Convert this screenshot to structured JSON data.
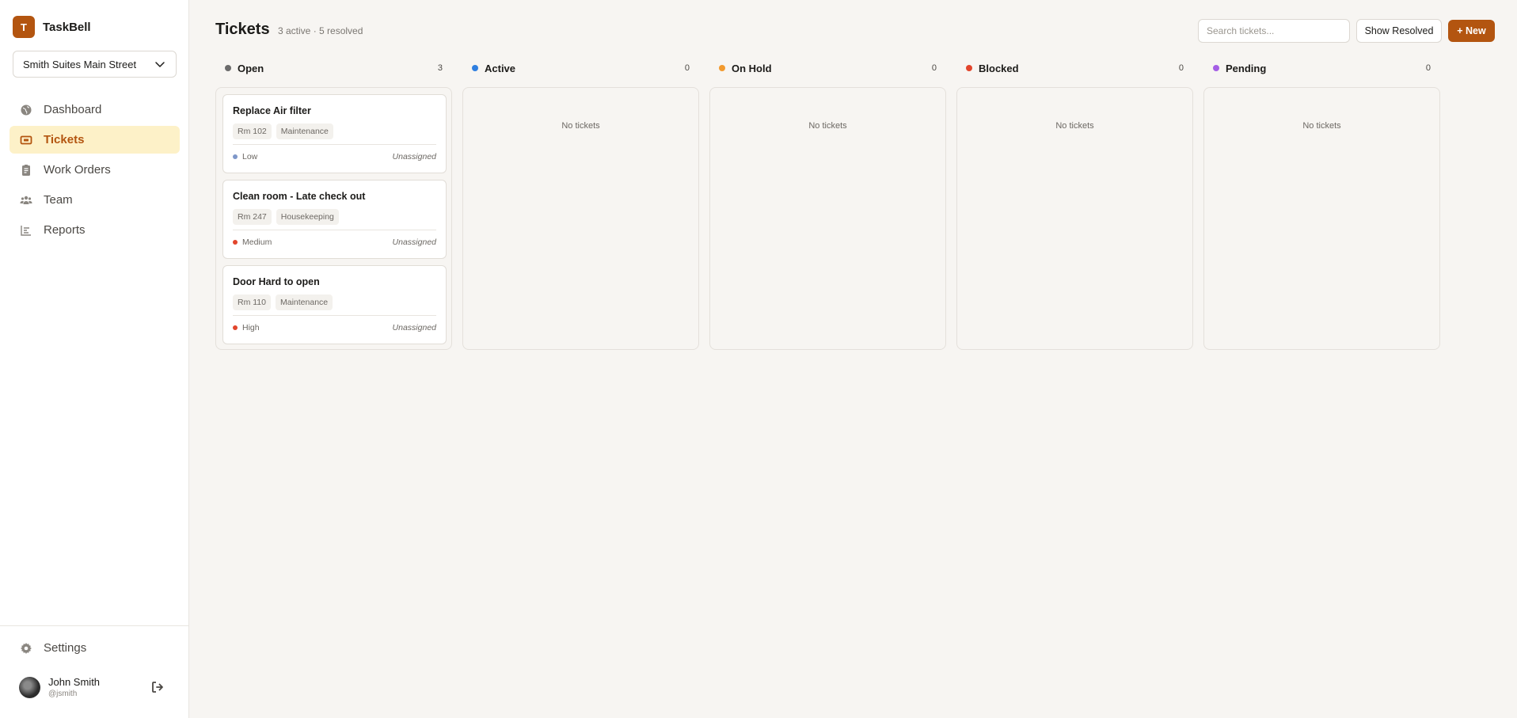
{
  "brand": {
    "logo_letter": "T",
    "name": "TaskBell",
    "accent": "#b35510"
  },
  "location": {
    "selected": "Smith Suites Main Street"
  },
  "nav": [
    {
      "id": "dashboard",
      "label": "Dashboard",
      "icon": "globe-icon"
    },
    {
      "id": "tickets",
      "label": "Tickets",
      "icon": "ticket-icon",
      "active": true
    },
    {
      "id": "work-orders",
      "label": "Work Orders",
      "icon": "clipboard-icon"
    },
    {
      "id": "team",
      "label": "Team",
      "icon": "users-icon"
    },
    {
      "id": "reports",
      "label": "Reports",
      "icon": "bar-chart-icon"
    }
  ],
  "settings": {
    "label": "Settings",
    "icon": "gear-icon"
  },
  "user": {
    "name": "John Smith",
    "handle": "@jsmith"
  },
  "header": {
    "title": "Tickets",
    "subtitle": "3 active · 5 resolved",
    "search_placeholder": "Search tickets...",
    "show_resolved_label": "Show Resolved",
    "new_label": "+ New"
  },
  "columns": [
    {
      "name": "Open",
      "count": "3",
      "color": "#6b6b6b",
      "empty_text": ""
    },
    {
      "name": "Active",
      "count": "0",
      "color": "#2f7fe0",
      "empty_text": "No tickets"
    },
    {
      "name": "On Hold",
      "count": "0",
      "color": "#f29a2e",
      "empty_text": "No tickets"
    },
    {
      "name": "Blocked",
      "count": "0",
      "color": "#e2452c",
      "empty_text": "No tickets"
    },
    {
      "name": "Pending",
      "count": "0",
      "color": "#a45ee5",
      "empty_text": "No tickets"
    }
  ],
  "tickets": [
    {
      "title": "Replace Air filter",
      "room": "Rm 102",
      "category": "Maintenance",
      "priority": "Low",
      "priority_color": "#7e97c9",
      "assignee": "Unassigned"
    },
    {
      "title": "Clean room - Late check out",
      "room": "Rm 247",
      "category": "Housekeeping",
      "priority": "Medium",
      "priority_color": "#e2452c",
      "assignee": "Unassigned"
    },
    {
      "title": "Door Hard to open",
      "room": "Rm 110",
      "category": "Maintenance",
      "priority": "High",
      "priority_color": "#e2452c",
      "assignee": "Unassigned"
    }
  ]
}
